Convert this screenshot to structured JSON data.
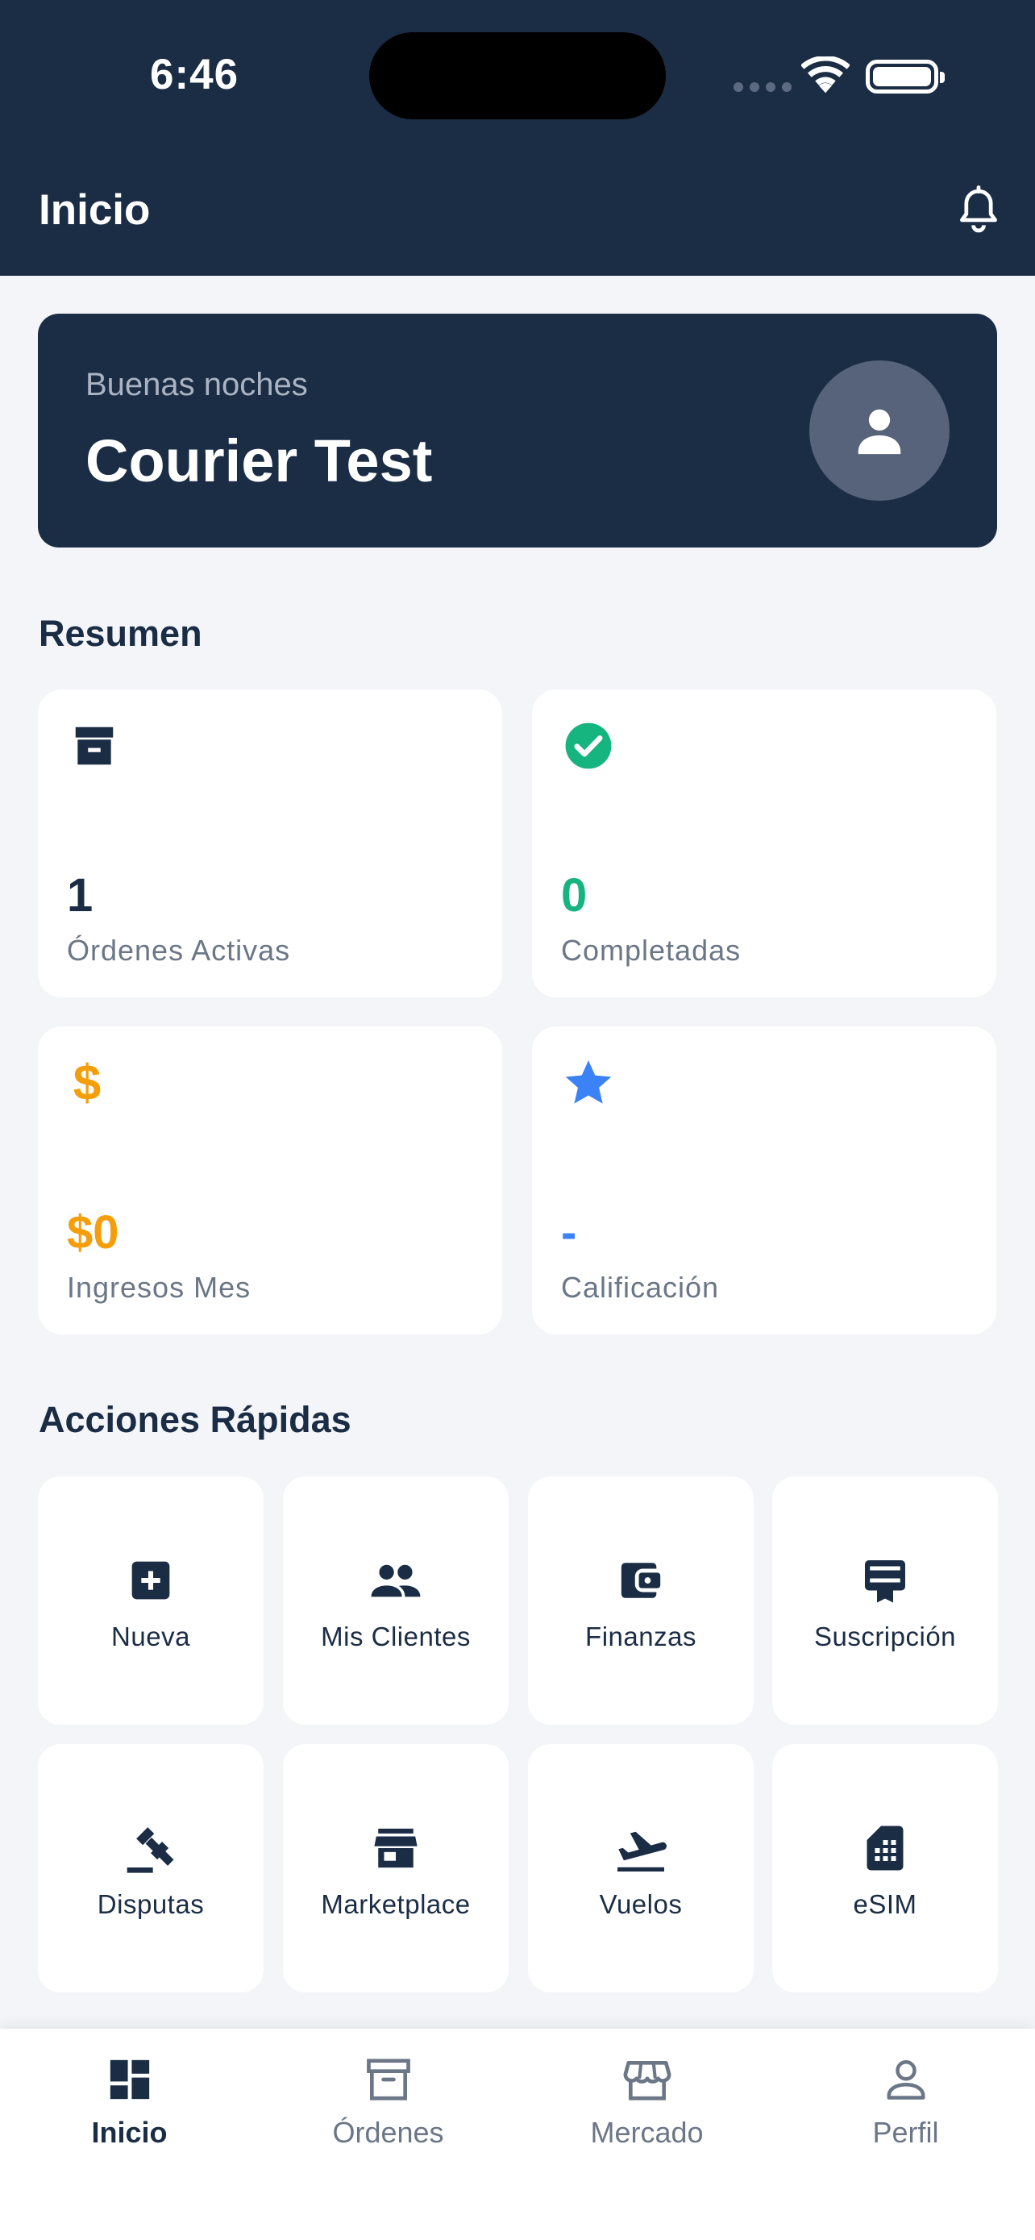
{
  "status_bar": {
    "time": "6:46"
  },
  "header": {
    "title": "Inicio"
  },
  "greeting": {
    "subtitle": "Buenas noches",
    "name": "Courier Test"
  },
  "summary": {
    "title": "Resumen",
    "cards": [
      {
        "value": "1",
        "label": "Órdenes Activas",
        "icon": "archive-icon",
        "color": "#1b2d45"
      },
      {
        "value": "0",
        "label": "Completadas",
        "icon": "check-circle-icon",
        "color": "#16b47e"
      },
      {
        "value": "$0",
        "label": "Ingresos Mes",
        "icon": "dollar-icon",
        "color": "#f59e0b"
      },
      {
        "value": "-",
        "label": "Calificación",
        "icon": "star-icon",
        "color": "#3b82f6"
      }
    ]
  },
  "quick_actions": {
    "title": "Acciones Rápidas",
    "items": [
      {
        "label": "Nueva",
        "icon": "add-box-icon"
      },
      {
        "label": "Mis Clientes",
        "icon": "people-icon"
      },
      {
        "label": "Finanzas",
        "icon": "wallet-icon"
      },
      {
        "label": "Suscripción",
        "icon": "card-membership-icon"
      },
      {
        "label": "Disputas",
        "icon": "gavel-icon"
      },
      {
        "label": "Marketplace",
        "icon": "store-icon"
      },
      {
        "label": "Vuelos",
        "icon": "flight-takeoff-icon"
      },
      {
        "label": "eSIM",
        "icon": "sim-card-icon"
      }
    ]
  },
  "bottom_nav": {
    "items": [
      {
        "label": "Inicio",
        "icon": "dashboard-icon",
        "active": true
      },
      {
        "label": "Órdenes",
        "icon": "archive-outline-icon",
        "active": false
      },
      {
        "label": "Mercado",
        "icon": "storefront-icon",
        "active": false
      },
      {
        "label": "Perfil",
        "icon": "person-icon",
        "active": false
      }
    ]
  },
  "colors": {
    "primary": "#1b2d45",
    "background": "#f3f5f9",
    "success": "#16b47e",
    "warning": "#f59e0b",
    "info": "#3b82f6",
    "muted": "#6b7686"
  }
}
